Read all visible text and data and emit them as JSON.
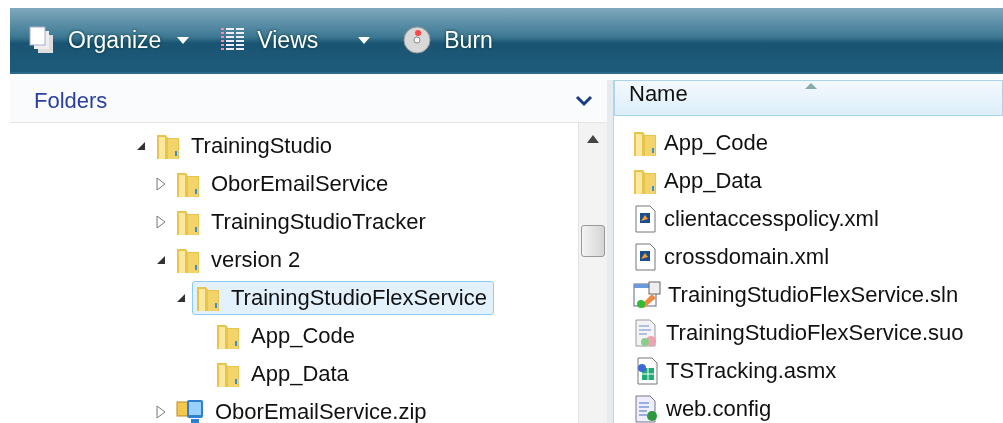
{
  "toolbar": {
    "buttons": [
      {
        "label": "Organize",
        "kind": "organize",
        "dropdown": true
      },
      {
        "label": "Views",
        "kind": "views",
        "dropdown": true
      },
      {
        "label": "Burn",
        "kind": "burn",
        "dropdown": false
      }
    ]
  },
  "folders_pane": {
    "title": "Folders",
    "tree": [
      {
        "label": "TrainingStudio",
        "kind": "folder",
        "expanded": true,
        "selected": false,
        "children": [
          {
            "label": "OborEmailService",
            "kind": "folder",
            "expanded": false,
            "selected": false
          },
          {
            "label": "TrainingStudioTracker",
            "kind": "folder",
            "expanded": false,
            "selected": false
          },
          {
            "label": "version 2",
            "kind": "folder",
            "expanded": true,
            "selected": false,
            "children": [
              {
                "label": "TrainingStudioFlexService",
                "kind": "folder",
                "expanded": true,
                "selected": true,
                "children": [
                  {
                    "label": "App_Code",
                    "kind": "folder",
                    "selected": false
                  },
                  {
                    "label": "App_Data",
                    "kind": "folder",
                    "selected": false
                  }
                ]
              }
            ]
          },
          {
            "label": "OborEmailService.zip",
            "kind": "zip",
            "expanded": false,
            "selected": false
          }
        ]
      }
    ]
  },
  "file_list": {
    "columns": [
      "Name"
    ],
    "files": [
      {
        "name": "App_Code",
        "kind": "folder"
      },
      {
        "name": "App_Data",
        "kind": "folder"
      },
      {
        "name": "clientaccesspolicy.xml",
        "kind": "xml"
      },
      {
        "name": "crossdomain.xml",
        "kind": "xml"
      },
      {
        "name": "TrainingStudioFlexService.sln",
        "kind": "sln"
      },
      {
        "name": "TrainingStudioFlexService.suo",
        "kind": "suo"
      },
      {
        "name": "TSTracking.asmx",
        "kind": "asmx"
      },
      {
        "name": "web.config",
        "kind": "config"
      }
    ]
  }
}
